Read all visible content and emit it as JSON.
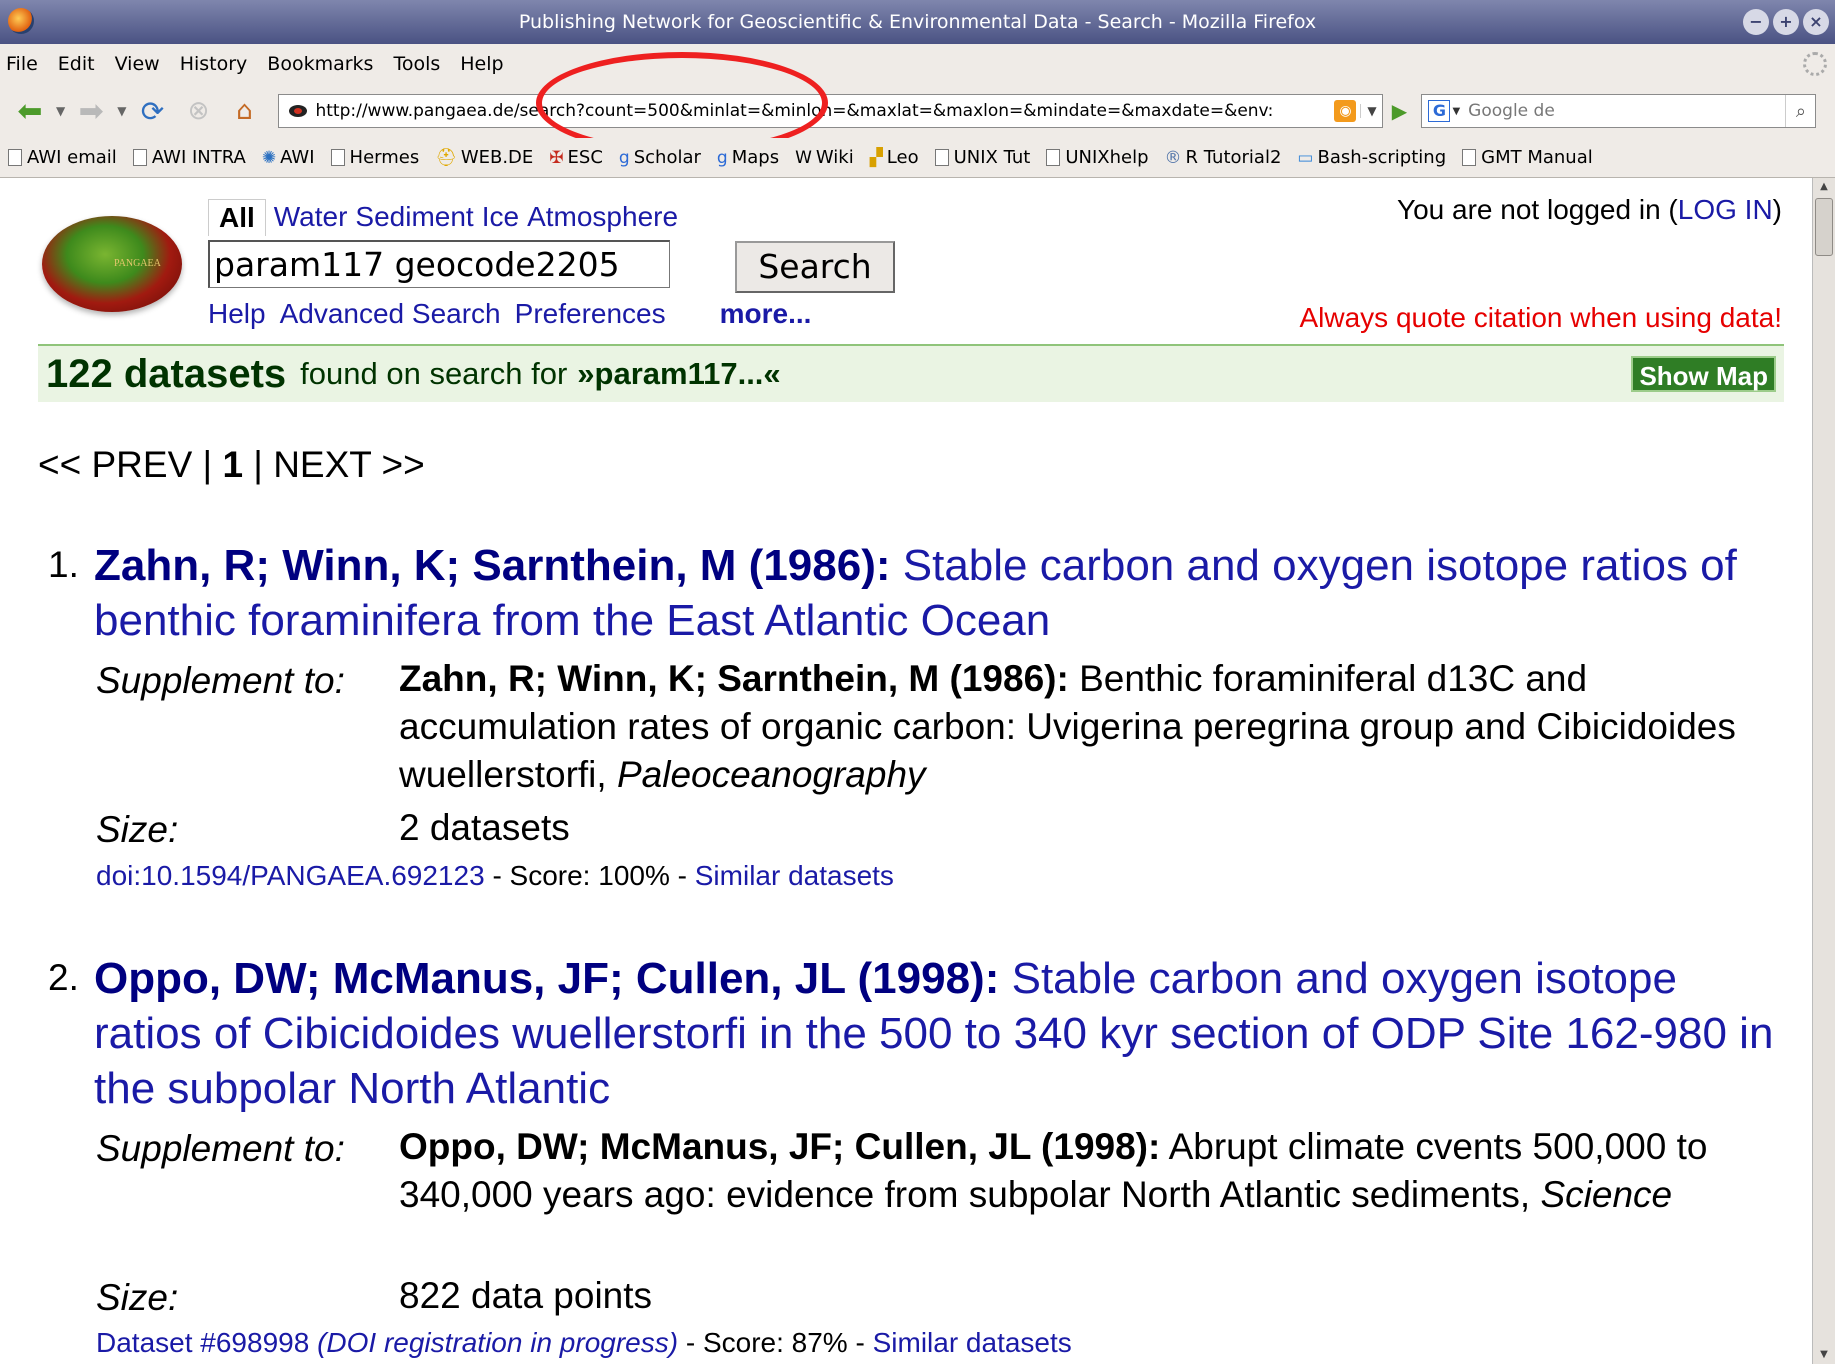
{
  "window": {
    "title": "Publishing Network for Geoscientific & Environmental Data - Search - Mozilla Firefox",
    "controls": [
      "−",
      "+",
      "×"
    ]
  },
  "menu": [
    "File",
    "Edit",
    "View",
    "History",
    "Bookmarks",
    "Tools",
    "Help"
  ],
  "nav": {
    "url": "http://www.pangaea.de/search?count=500&minlat=&minlon=&maxlat=&maxlon=&mindate=&maxdate=&env:",
    "search_placeholder": "Google de",
    "search_engine": "G"
  },
  "bookmarks": [
    {
      "label": "AWI email",
      "icon": "page-icon"
    },
    {
      "label": "AWI INTRA",
      "icon": "page-icon"
    },
    {
      "label": "AWI",
      "icon": "awi-icon"
    },
    {
      "label": "Hermes",
      "icon": "page-icon"
    },
    {
      "label": "WEB.DE",
      "icon": "webde-icon"
    },
    {
      "label": "ESC",
      "icon": "esc-icon"
    },
    {
      "label": "Scholar",
      "icon": "google-icon"
    },
    {
      "label": "Maps",
      "icon": "google-icon"
    },
    {
      "label": "Wiki",
      "icon": "wikipedia-icon"
    },
    {
      "label": "Leo",
      "icon": "leo-icon"
    },
    {
      "label": "UNIX Tut",
      "icon": "page-icon"
    },
    {
      "label": "UNIXhelp",
      "icon": "page-icon"
    },
    {
      "label": "R Tutorial2",
      "icon": "r-icon"
    },
    {
      "label": "Bash-scripting",
      "icon": "folder-icon"
    },
    {
      "label": "GMT Manual",
      "icon": "page-icon"
    }
  ],
  "page": {
    "logo_text": "PANGAEA",
    "scopes": [
      "All",
      "Water",
      "Sediment",
      "Ice",
      "Atmosphere"
    ],
    "query": "param117 geocode2205",
    "search_button": "Search",
    "links": {
      "help": "Help",
      "advanced": "Advanced Search",
      "preferences": "Preferences",
      "more": "more..."
    },
    "login_prefix": "You are not logged in (",
    "login_link": "LOG IN",
    "login_suffix": ")",
    "quote_notice": "Always quote citation when using data!",
    "result_count": "122 datasets",
    "result_text": "found on search for",
    "result_query": "»param117...«",
    "show_map": "Show Map",
    "pager": {
      "prev": "<< PREV |",
      "current": "1",
      "next": "| NEXT >>"
    }
  },
  "results": [
    {
      "num": "1.",
      "authors": "Zahn, R; Winn, K; Sarnthein, M (1986):",
      "title": "Stable carbon and oxygen isotope ratios of benthic foraminifera from the East Atlantic Ocean",
      "supplement_label": "Supplement to:",
      "supp_authors": "Zahn, R; Winn, K; Sarnthein, M (1986):",
      "supp_text": "Benthic foraminiferal d13C and accumulation rates of organic carbon: Uvigerina peregrina group and Cibicidoides wuellerstorfi,",
      "supp_journal": "Paleoceanography",
      "size_label": "Size:",
      "size": "2 datasets",
      "id_link": "doi:10.1594/PANGAEA.692123",
      "id_note": "",
      "score": "- Score: 100% -",
      "similar": "Similar datasets"
    },
    {
      "num": "2.",
      "authors": "Oppo, DW; McManus, JF; Cullen, JL (1998):",
      "title": "Stable carbon and oxygen isotope ratios of Cibicidoides wuellerstorfi in the 500 to 340 kyr section of ODP Site 162-980 in the subpolar North Atlantic",
      "supplement_label": "Supplement to:",
      "supp_authors": "Oppo, DW; McManus, JF; Cullen, JL (1998):",
      "supp_text": "Abrupt climate cvents 500,000 to 340,000 years ago: evidence from subpolar North Atlantic sediments,",
      "supp_journal": "Science",
      "size_label": "Size:",
      "size": "822 data points",
      "id_link": "Dataset #698998",
      "id_note": "(DOI registration in progress)",
      "score": "- Score: 87% -",
      "similar": "Similar datasets"
    }
  ],
  "colors": {
    "link": "#1a1aa6",
    "notice": "#e60000",
    "result_bar": "#eaf4e3",
    "show_map": "#2f7d25",
    "highlight": "#ee2020"
  }
}
